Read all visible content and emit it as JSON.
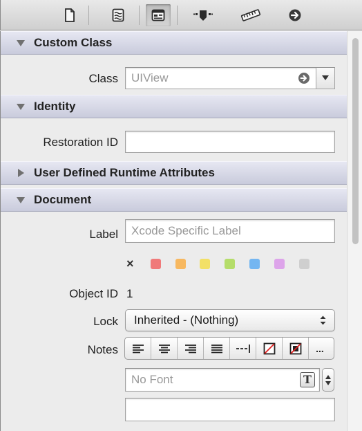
{
  "toolbar": {
    "tabs": [
      {
        "icon": "file-icon"
      },
      {
        "icon": "quick-help-icon"
      },
      {
        "icon": "identity-icon",
        "active": true
      },
      {
        "icon": "attributes-icon"
      },
      {
        "icon": "size-ruler-icon"
      },
      {
        "icon": "connections-arrow-icon"
      }
    ]
  },
  "sections": {
    "custom_class": {
      "title": "Custom Class",
      "class_label": "Class",
      "class_placeholder": "UIView"
    },
    "identity": {
      "title": "Identity",
      "restoration_label": "Restoration ID",
      "restoration_value": ""
    },
    "user_defined": {
      "title": "User Defined Runtime Attributes"
    },
    "document": {
      "title": "Document",
      "label_label": "Label",
      "label_placeholder": "Xcode Specific Label",
      "clear_label": "×",
      "label_colors": [
        "#f07a7a",
        "#f7b860",
        "#f2e066",
        "#b5dd6a",
        "#74b6f1",
        "#dda4ea",
        "#cfcfcf"
      ],
      "object_id_label": "Object ID",
      "object_id_value": "1",
      "lock_label": "Lock",
      "lock_value": "Inherited - (Nothing)",
      "notes_label": "Notes",
      "font_placeholder": "No Font",
      "font_icon_glyph": "T",
      "more_glyph": "..."
    }
  }
}
